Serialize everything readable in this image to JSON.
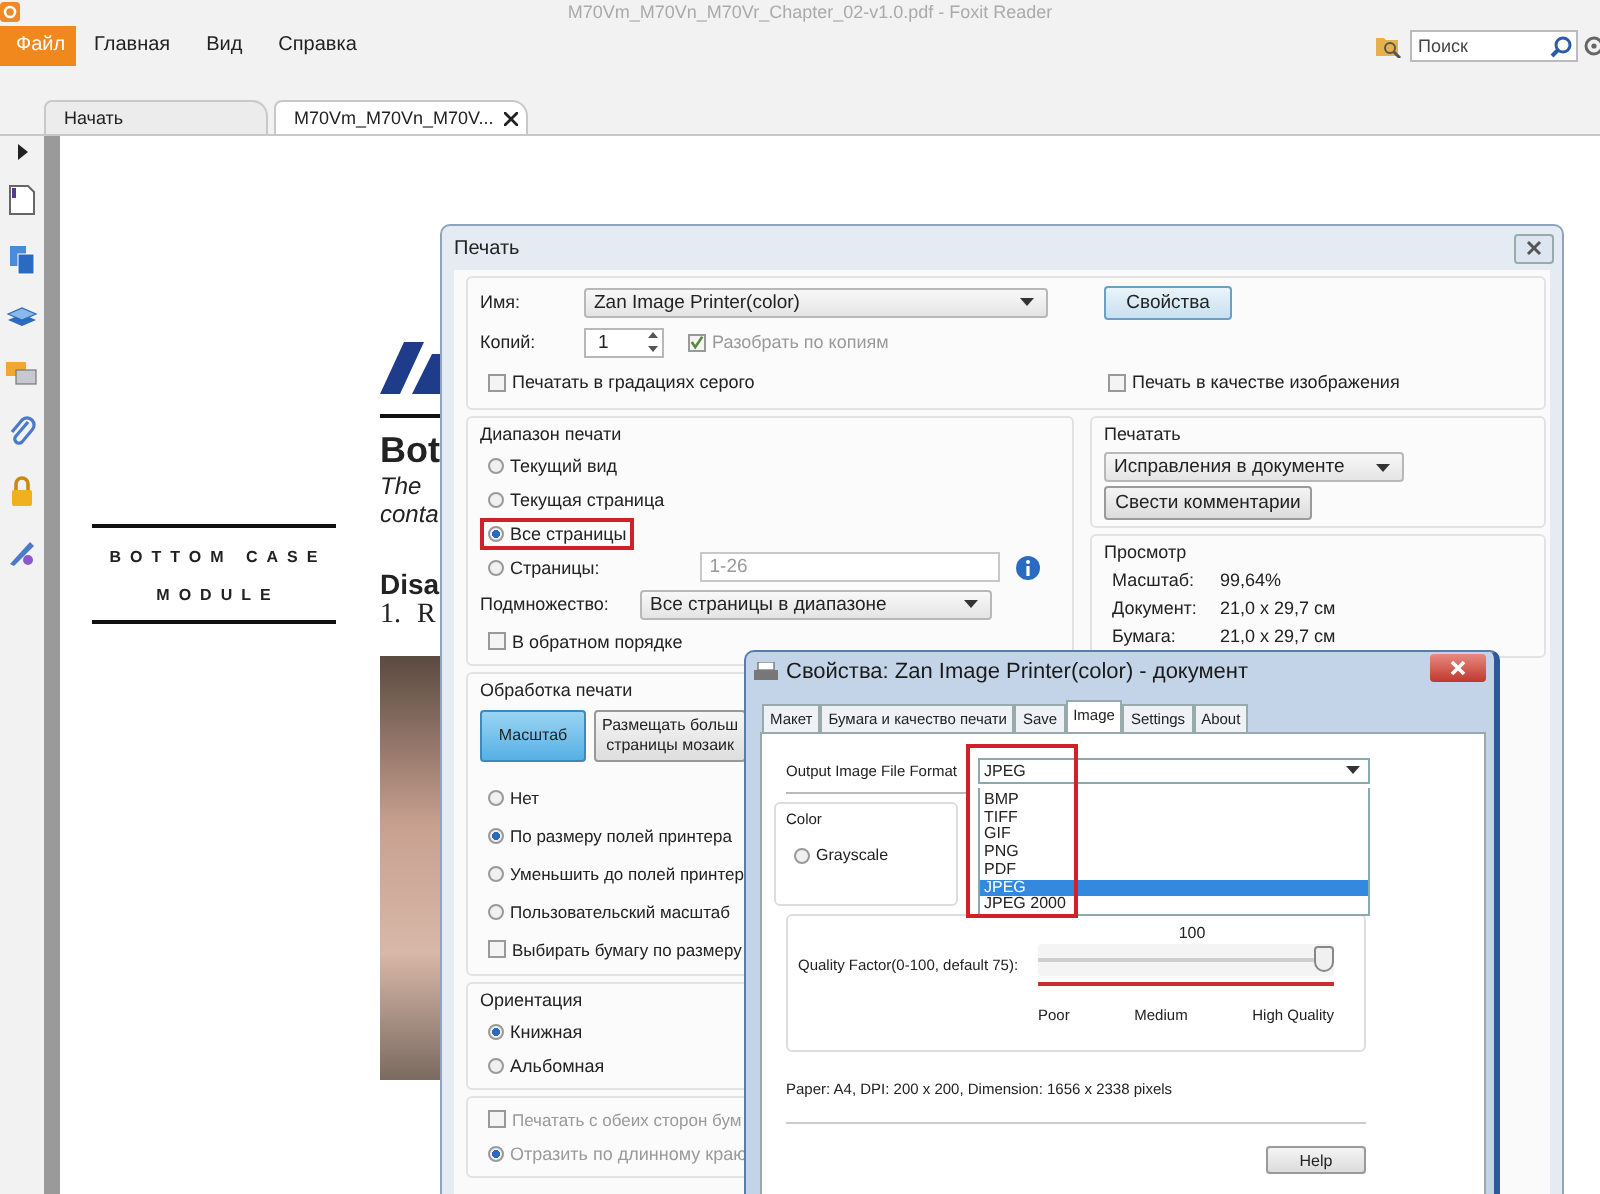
{
  "app": {
    "title": "M70Vm_M70Vn_M70Vr_Chapter_02-v1.0.pdf - Foxit Reader",
    "menu": [
      {
        "label": "Файл",
        "selected": true
      },
      {
        "label": "Главная",
        "selected": false
      },
      {
        "label": "Вид",
        "selected": false
      },
      {
        "label": "Справка",
        "selected": false
      }
    ],
    "search": {
      "placeholder": "Поиск"
    },
    "tabs": [
      {
        "label": "Начать",
        "selected": false,
        "closable": false
      },
      {
        "label": "M70Vm_M70Vn_M70V...",
        "selected": true,
        "closable": true
      }
    ]
  },
  "document": {
    "side_heading": [
      "BOTTOM CASE",
      "MODULE"
    ],
    "heading": "Bot",
    "intro": [
      "The",
      "conta"
    ],
    "section": "Disa",
    "step": {
      "number": "1.",
      "text": "R"
    }
  },
  "print_dialog": {
    "title": "Печать",
    "printer": {
      "label": "Имя:",
      "value": "Zan Image Printer(color)"
    },
    "properties_button": "Свойства",
    "copies": {
      "label": "Копий:",
      "value": "1"
    },
    "collate": {
      "label": "Разобрать по копиям",
      "checked": true,
      "disabled": true
    },
    "grayscale": {
      "label": "Печатать в градациях серого",
      "checked": false
    },
    "print_as_image": {
      "label": "Печать в качестве изображения",
      "checked": false
    },
    "range": {
      "title": "Диапазон печати",
      "options": [
        {
          "label": "Текущий вид",
          "selected": false,
          "highlighted": false
        },
        {
          "label": "Текущая страница",
          "selected": false,
          "highlighted": false
        },
        {
          "label": "Все страницы",
          "selected": true,
          "highlighted": true
        },
        {
          "label": "Страницы:",
          "selected": false,
          "highlighted": false
        }
      ],
      "pages": {
        "placeholder": "1-26"
      },
      "subset": {
        "label": "Подмножество:",
        "value": "Все страницы в диапазоне"
      },
      "reverse": {
        "label": "В обратном порядке",
        "checked": false
      }
    },
    "handling": {
      "title": "Обработка печати",
      "modes": [
        {
          "label": "Масштаб",
          "selected": true
        },
        {
          "label": "Размещать больш\nстраницы мозаик",
          "selected": false
        }
      ],
      "scaling": [
        {
          "kind": "radio",
          "label": "Нет",
          "selected": false
        },
        {
          "kind": "radio",
          "label": "По размеру полей принтера",
          "selected": true
        },
        {
          "kind": "radio",
          "label": "Уменьшить до полей принтер",
          "selected": false
        },
        {
          "kind": "radio",
          "label": "Пользовательский масштаб",
          "selected": false
        },
        {
          "kind": "checkbox",
          "label": "Выбирать бумагу по размеру",
          "checked": false
        }
      ]
    },
    "orientation": {
      "title": "Ориентация",
      "options": [
        {
          "label": "Книжная",
          "selected": true
        },
        {
          "label": "Альбомная",
          "selected": false
        }
      ]
    },
    "duplex": {
      "label": "Печатать с обеих сторон бум",
      "checked": false,
      "disabled": true
    },
    "flip": {
      "label": "Отразить по длинному краю",
      "selected": true,
      "disabled": true
    },
    "output": {
      "title": "Печатать",
      "value": "Исправления в документе",
      "button": "Свести комментарии"
    },
    "preview": {
      "title": "Просмотр",
      "rows": [
        {
          "label": "Масштаб:",
          "value": "99,64%"
        },
        {
          "label": "Документ:",
          "value": "21,0 x 29,7 см"
        },
        {
          "label": "Бумага:",
          "value": "21,0 x 29,7 см"
        }
      ]
    }
  },
  "properties_dialog": {
    "title": "Свойства: Zan Image Printer(color) - документ",
    "tabs": [
      {
        "label": "Макет",
        "selected": false
      },
      {
        "label": "Бумага и качество печати",
        "selected": false
      },
      {
        "label": "Save",
        "selected": false
      },
      {
        "label": "Image",
        "selected": true
      },
      {
        "label": "Settings",
        "selected": false
      },
      {
        "label": "About",
        "selected": false
      }
    ],
    "format": {
      "label": "Output Image File Format",
      "value": "JPEG",
      "expanded": true,
      "highlighted": true,
      "options": [
        {
          "label": "BMP",
          "selected": false
        },
        {
          "label": "TIFF",
          "selected": false
        },
        {
          "label": "GIF",
          "selected": false
        },
        {
          "label": "PNG",
          "selected": false
        },
        {
          "label": "PDF",
          "selected": false
        },
        {
          "label": "JPEG",
          "selected": true
        },
        {
          "label": "JPEG 2000",
          "selected": false
        }
      ]
    },
    "color": {
      "title": "Color",
      "grayscale": {
        "label": "Grayscale",
        "selected": false
      }
    },
    "quality": {
      "label": "Quality Factor(0-100, default 75):",
      "reading": "100",
      "level": 1,
      "underlined": true,
      "marks": [
        "Poor",
        "Medium",
        "High Quality"
      ]
    },
    "info": "Paper: A4, DPI: 200 x 200, Dimension: 1656 x 2338 pixels",
    "help_button": "Help"
  }
}
